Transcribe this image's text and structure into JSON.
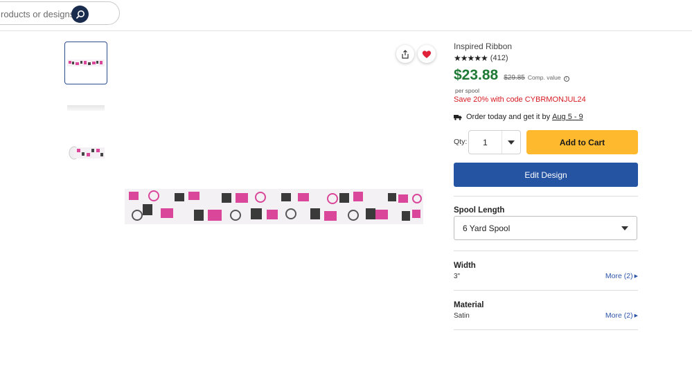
{
  "search": {
    "placeholder": "roducts or designs"
  },
  "product": {
    "brand": "Inspired Ribbon",
    "stars": "★★★★★",
    "review_count": "(412)",
    "price": "$23.88",
    "comp_price": "$29.85",
    "comp_label": "Comp. value",
    "info_glyph": "i",
    "per_unit": "per spool",
    "promo": "Save 20% with code CYBRMONJUL24",
    "delivery_text": "Order today and get it by",
    "delivery_date": "Aug 5 - 9",
    "qty_label": "Qty:",
    "qty_value": "1",
    "add_to_cart": "Add to Cart",
    "edit_design": "Edit Design"
  },
  "options": {
    "spool_length": {
      "title": "Spool Length",
      "selected": "6 Yard Spool"
    },
    "width": {
      "title": "Width",
      "value": "3\"",
      "more": "More (2)"
    },
    "material": {
      "title": "Material",
      "value": "Satin",
      "more": "More (2)"
    }
  },
  "colors": {
    "price": "#1e7a35",
    "promo": "#d71920",
    "cart": "#ffb92e",
    "edit": "#2554a3",
    "favorite": "#e0213a"
  },
  "icons": [
    "search-icon",
    "share-icon",
    "heart-icon",
    "truck-icon",
    "chevron-down-icon",
    "caret-right-icon"
  ]
}
